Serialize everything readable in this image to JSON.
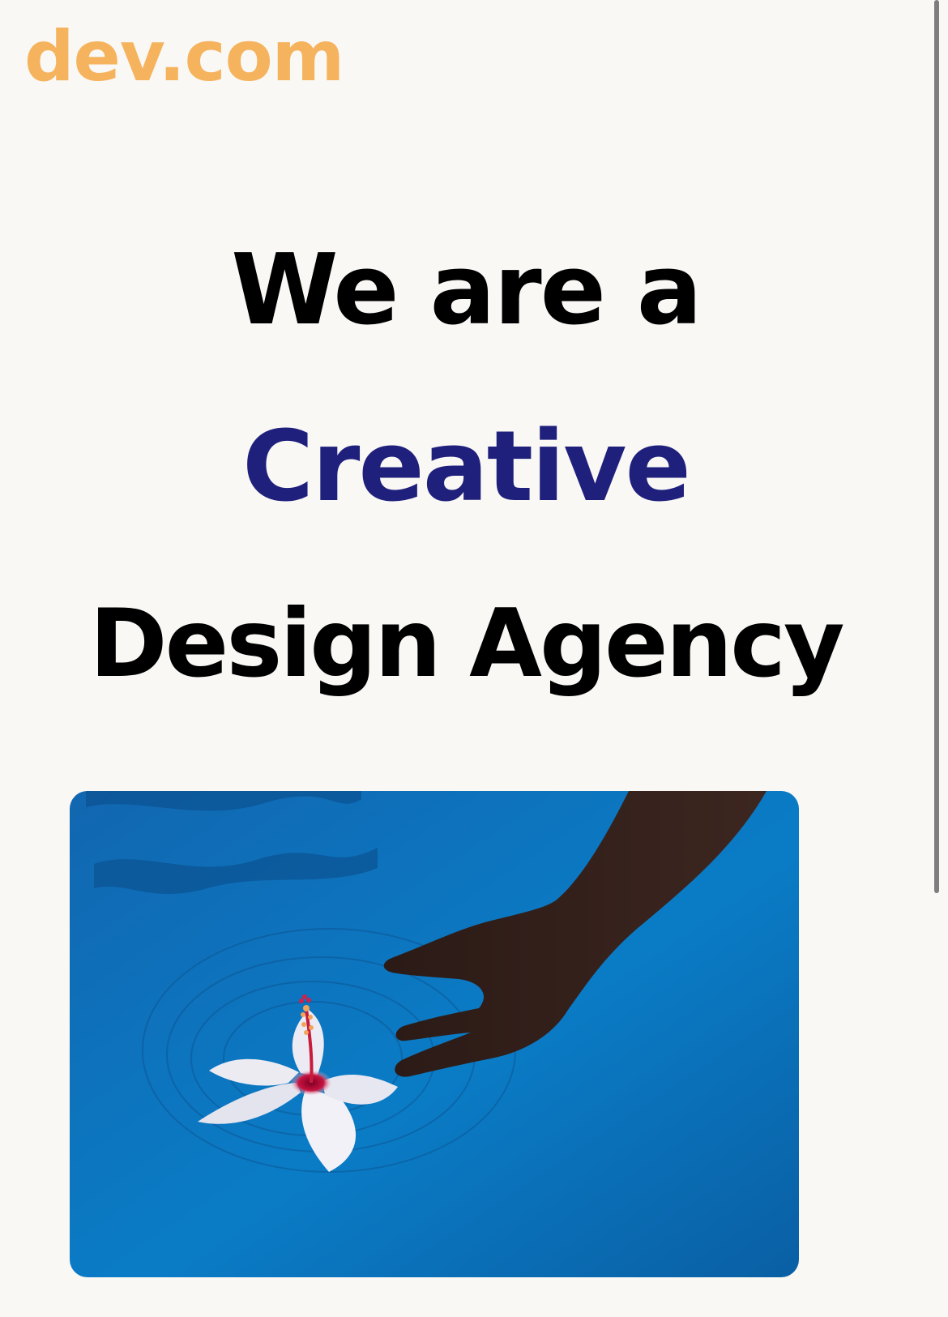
{
  "brand": {
    "logo_text": "dev.com",
    "logo_color": "#f6b35e"
  },
  "hero": {
    "line1": "We are a",
    "line2": "Creative",
    "line3": "Design Agency",
    "text_color": "#000000",
    "accent_color": "#1f1f7c"
  },
  "photo": {
    "water_color": "#0a79c4"
  },
  "scrollbar": {
    "color": "#7e7e7e"
  }
}
